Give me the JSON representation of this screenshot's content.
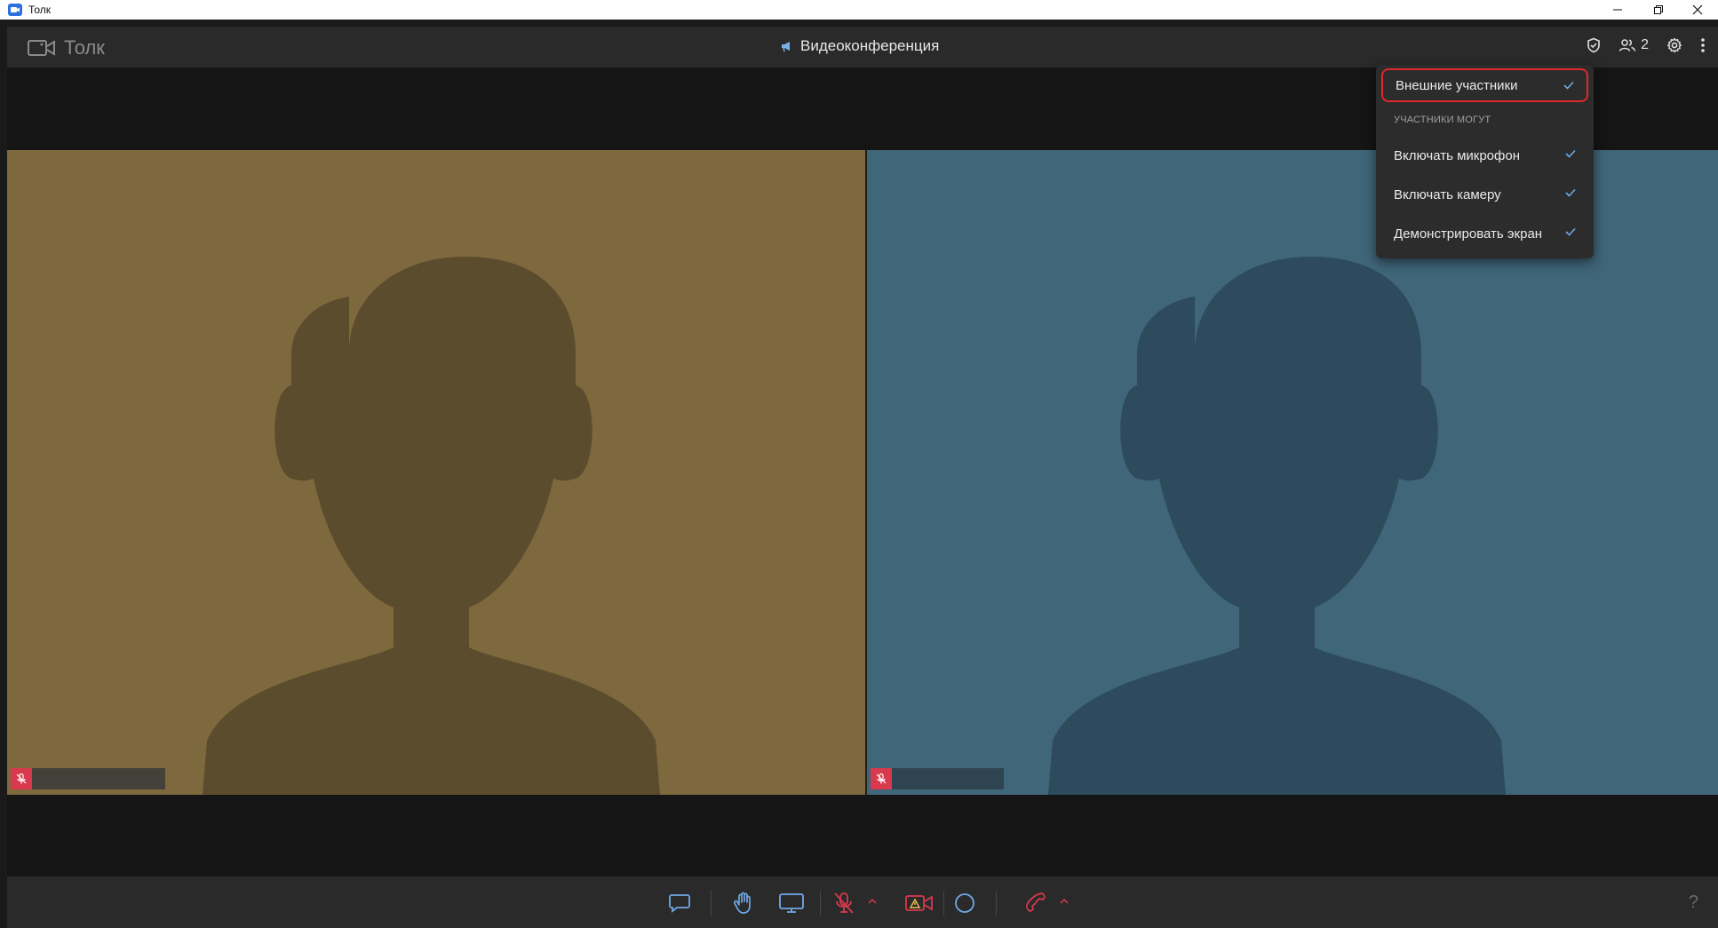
{
  "window": {
    "title": "Толк",
    "controls": [
      "minimize-icon",
      "restore-icon",
      "close-icon"
    ]
  },
  "header": {
    "brand": "Толк",
    "conference_title": "Видеоконференция",
    "participants_count": "2",
    "icons": [
      "shield-check-icon",
      "participants-icon",
      "gear-icon",
      "more-vertical-icon"
    ]
  },
  "menu": {
    "external_participants": "Внешние участники",
    "section_label": "УЧАСТНИКИ МОГУТ",
    "items": [
      {
        "label": "Включать микрофон",
        "checked": true
      },
      {
        "label": "Включать камеру",
        "checked": true
      },
      {
        "label": "Демонстрировать экран",
        "checked": true
      }
    ],
    "external_checked": true
  },
  "tiles": [
    {
      "bg": "#7e683d",
      "silhouette": "#5c4c2e",
      "muted": true
    },
    {
      "bg": "#3f6679",
      "silhouette": "#2d4b5c",
      "muted": true
    }
  ],
  "toolbar": {
    "buttons": [
      "chat-icon",
      "raise-hand-icon",
      "screen-share-icon",
      "mic-muted-icon",
      "camera-off-warning-icon",
      "record-icon",
      "end-call-icon"
    ],
    "help": "?"
  },
  "colors": {
    "accent_red": "#d9394d",
    "highlight_border": "#e0272c",
    "header_bg": "#2a2a2a",
    "stage_bg": "#151515"
  }
}
